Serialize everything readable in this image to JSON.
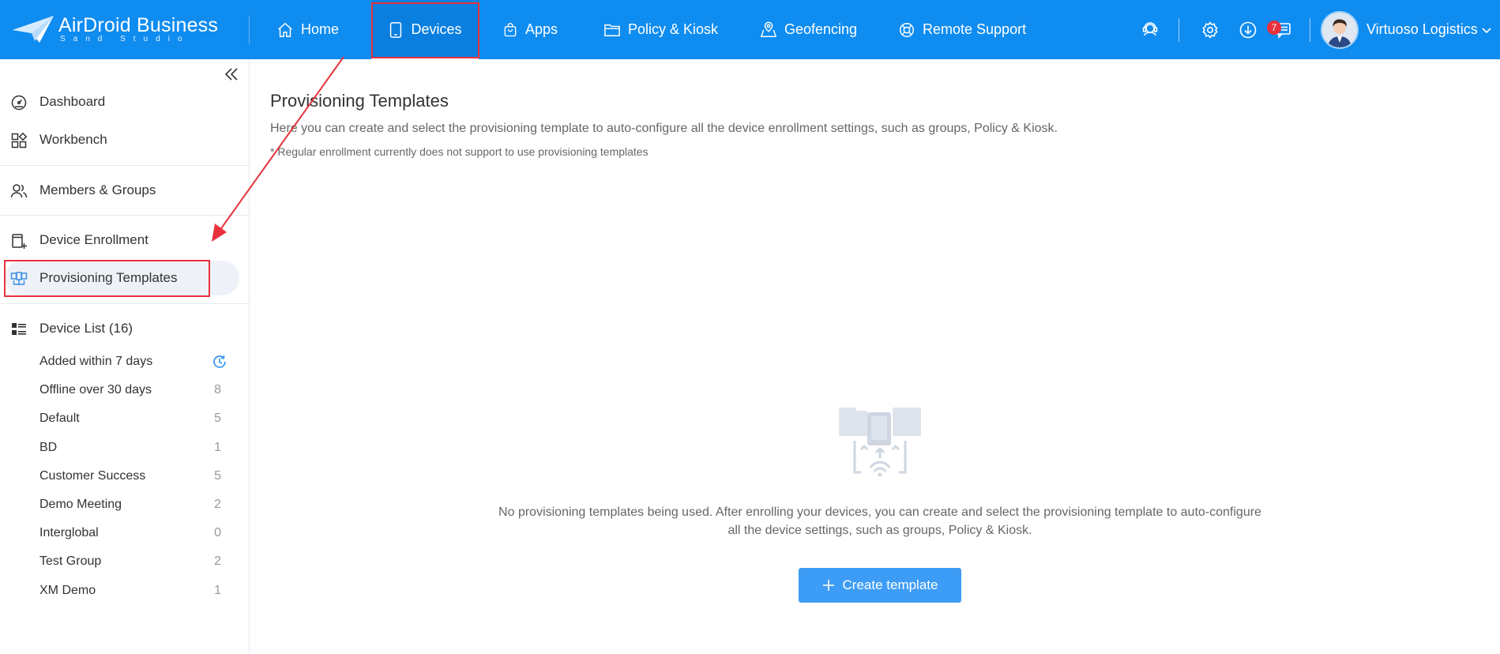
{
  "brand": {
    "name": "AirDroid Business",
    "sub": "Sand Studio"
  },
  "nav": {
    "home": "Home",
    "devices": "Devices",
    "apps": "Apps",
    "policy": "Policy & Kiosk",
    "geofencing": "Geofencing",
    "remote_support": "Remote Support"
  },
  "header": {
    "notification_count": "7",
    "user_name": "Virtuoso Logistics"
  },
  "sidebar": {
    "dashboard": "Dashboard",
    "workbench": "Workbench",
    "members_groups": "Members & Groups",
    "device_enrollment": "Device Enrollment",
    "provisioning_templates": "Provisioning Templates",
    "device_list": "Device List (16)",
    "groups": [
      {
        "label": "Added within 7 days",
        "count": ""
      },
      {
        "label": "Offline over 30 days",
        "count": "8"
      },
      {
        "label": "Default",
        "count": "5"
      },
      {
        "label": "BD",
        "count": "1"
      },
      {
        "label": "Customer Success",
        "count": "5"
      },
      {
        "label": "Demo Meeting",
        "count": "2"
      },
      {
        "label": "Interglobal",
        "count": "0"
      },
      {
        "label": "Test Group",
        "count": "2"
      },
      {
        "label": "XM Demo",
        "count": "1"
      }
    ]
  },
  "main": {
    "title": "Provisioning Templates",
    "description": "Here you can create and select the provisioning template to auto-configure all the device enrollment settings, such as groups, Policy & Kiosk.",
    "note": "* Regular enrollment currently does not support to use provisioning templates",
    "empty_line1": "No provisioning templates being used. After enrolling your devices, you can create and select the provisioning template to auto-configure",
    "empty_line2": "all the device settings, such as groups, Policy & Kiosk.",
    "create_button": "Create template"
  },
  "colors": {
    "topbar": "#0f8cf0",
    "accent": "#3d9cf5",
    "highlight_box": "#e8323c",
    "badge": "#e8323c"
  }
}
